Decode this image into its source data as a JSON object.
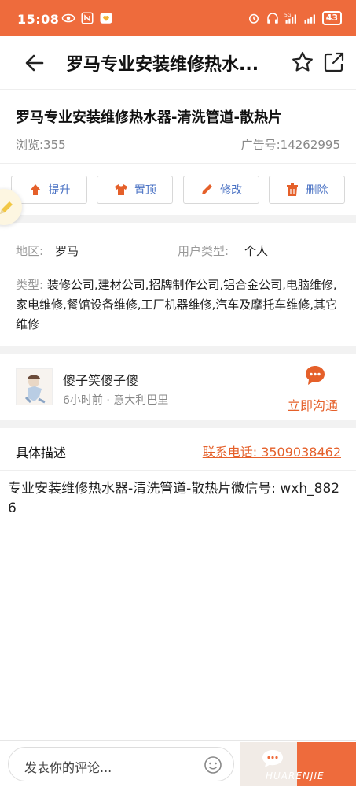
{
  "status_bar": {
    "time": "15:08",
    "battery": "43",
    "network": "5G"
  },
  "header": {
    "title": "罗马专业安装维修热水..."
  },
  "ad": {
    "title": "罗马专业安装维修热水器-清洗管道-散热片",
    "views": "浏览:355",
    "ad_number": "广告号:14262995"
  },
  "actions": [
    {
      "label": "提升",
      "icon": "arrow-up-icon"
    },
    {
      "label": "置顶",
      "icon": "shirt-icon"
    },
    {
      "label": "修改",
      "icon": "pencil-icon"
    },
    {
      "label": "删除",
      "icon": "trash-icon"
    }
  ],
  "info": {
    "region_label": "地区:",
    "region_value": "罗马",
    "user_type_label": "用户类型:",
    "user_type_value": "个人",
    "category_label": "类型:",
    "category_value": "装修公司,建材公司,招牌制作公司,铝合金公司,电脑维修,家电维修,餐馆设备维修,工厂机器维修,汽车及摩托车维修,其它维修"
  },
  "user": {
    "name": "傻子笑傻子傻",
    "meta": "6小时前 · 意大利巴里",
    "chat_label": "立即沟通"
  },
  "description": {
    "heading": "具体描述",
    "phone": "联系电话: 3509038462",
    "body": "专业安装维修热水器-清洗管道-散热片微信号: wxh_8826"
  },
  "comment": {
    "placeholder": "发表你的评论..."
  },
  "logo": {
    "text": "HUARENJIE"
  },
  "colors": {
    "accent": "#ee6b3c",
    "link_blue": "#4a72c4",
    "action_red": "#e5602a"
  }
}
